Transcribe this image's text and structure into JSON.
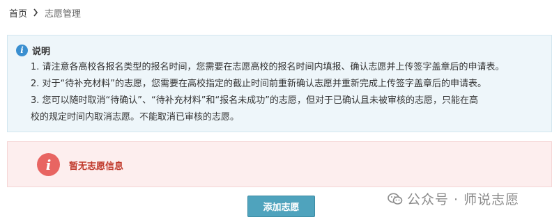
{
  "breadcrumb": {
    "home": "首页",
    "current": "志愿管理"
  },
  "notice": {
    "title": "说明",
    "lines": [
      "1. 请注意各高校各报名类型的报名时间，您需要在志愿高校的报名时间内填报、确认志愿并上传签字盖章后的申请表。",
      "2. 对于“待补充材料”的志愿，您需要在高校指定的截止时间前重新确认志愿并重新完成上传签字盖章后的申请表。",
      "3. 您可以随时取消“待确认”、“待补充材料”和“报名未成功”的志愿，但对于已确认且未被审核的志愿，只能在高",
      "校的规定时间内取消志愿。不能取消已审核的志愿。"
    ]
  },
  "empty_state": {
    "message": "暂无志愿信息"
  },
  "actions": {
    "add_label": "添加志愿"
  },
  "watermark": {
    "text": "公众号 · 师说志愿"
  },
  "colors": {
    "info_bg": "#eef6fa",
    "info_icon": "#3a8fd0",
    "error_bg": "#fdeeee",
    "error_icon": "#e86562",
    "error_text": "#c0392b",
    "button_bg": "#4fa3bd"
  }
}
